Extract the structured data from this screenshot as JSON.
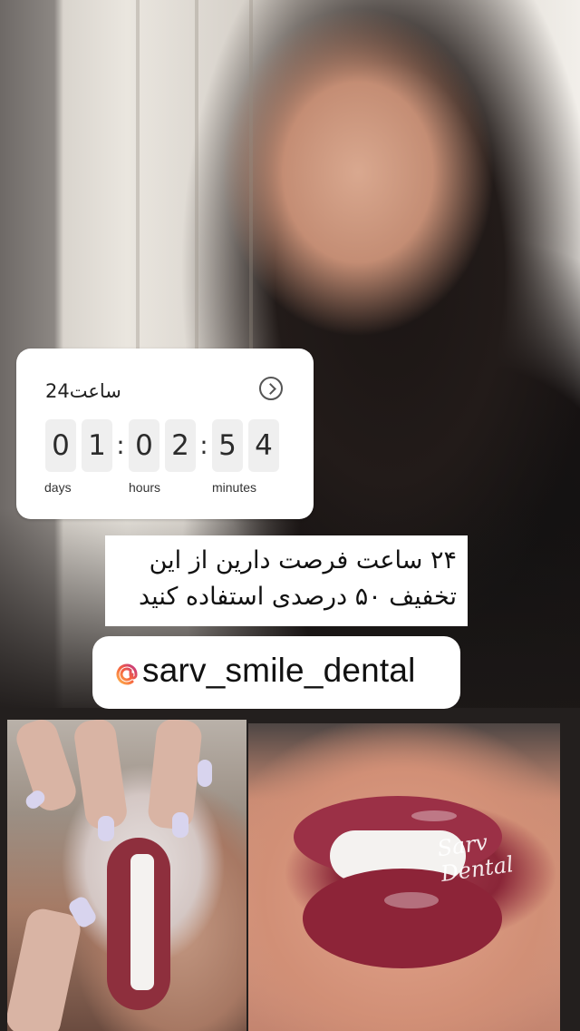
{
  "countdown": {
    "title": "ساعت24",
    "digits": [
      "0",
      "1",
      "0",
      "2",
      "5",
      "4"
    ],
    "units": {
      "days": "days",
      "hours": "hours",
      "minutes": "minutes"
    }
  },
  "banner": {
    "line1": "۲۴ ساعت فرصت دارین از این",
    "line2": "تخفیف ۵۰ درصدی استفاده کنید"
  },
  "mention": {
    "handle": "sarv_smile_dental",
    "accent": "#f56040"
  },
  "photos": {
    "watermark": "Sarv Dental"
  }
}
